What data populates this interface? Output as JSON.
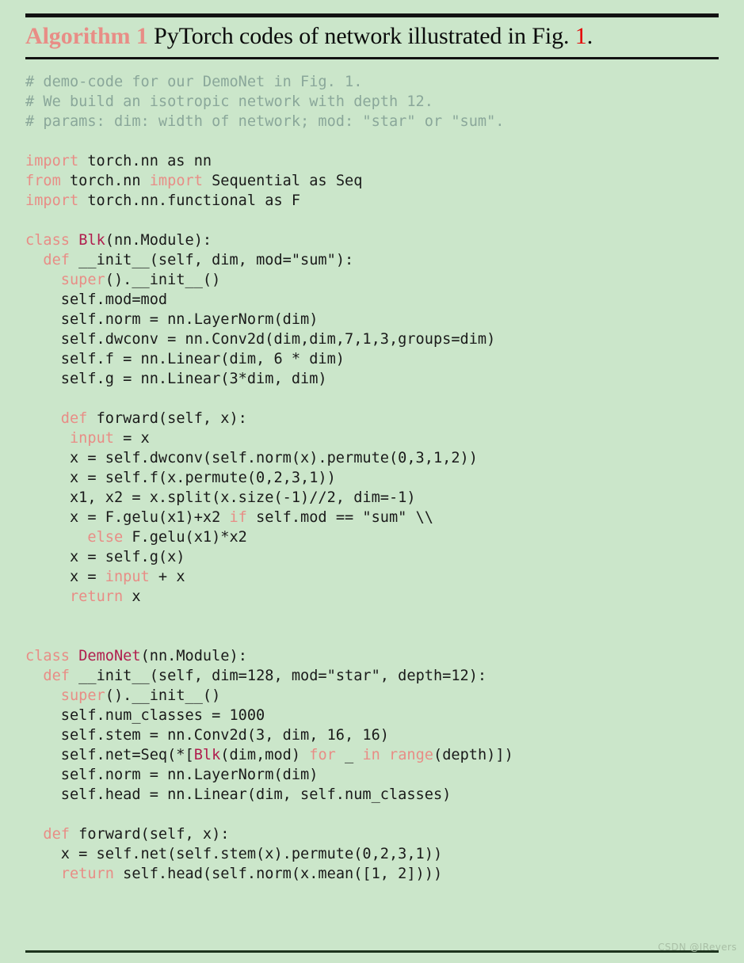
{
  "document": {
    "background_color": "#cbe6ca",
    "rule_color": "#121212"
  },
  "title": {
    "label": "Algorithm 1",
    "text_before": " PyTorch codes of network illustrated in Fig. ",
    "fig_number": "1",
    "text_after": "."
  },
  "colors": {
    "comment": "#8aa79a",
    "keyword": "#e88d86",
    "class_name": "#b01e4e",
    "plain": "#1a1a1a",
    "fig_number": "#e50000"
  },
  "code": {
    "language": "python",
    "lines": [
      [
        {
          "t": "# demo-code for our DemoNet in Fig. 1.",
          "c": "cm"
        }
      ],
      [
        {
          "t": "# We build an isotropic network with depth 12.",
          "c": "cm"
        }
      ],
      [
        {
          "t": "# params: dim: width of network; mod: \"star\" or \"sum\".",
          "c": "cm"
        }
      ],
      [
        {
          "t": "",
          "c": "pl"
        }
      ],
      [
        {
          "t": "import",
          "c": "kw"
        },
        {
          "t": " torch.nn as nn",
          "c": "pl"
        }
      ],
      [
        {
          "t": "from",
          "c": "kw"
        },
        {
          "t": " torch.nn ",
          "c": "pl"
        },
        {
          "t": "import",
          "c": "kw"
        },
        {
          "t": " Sequential as Seq",
          "c": "pl"
        }
      ],
      [
        {
          "t": "import",
          "c": "kw"
        },
        {
          "t": " torch.nn.functional as F",
          "c": "pl"
        }
      ],
      [
        {
          "t": "",
          "c": "pl"
        }
      ],
      [
        {
          "t": "class",
          "c": "kw"
        },
        {
          "t": " ",
          "c": "pl"
        },
        {
          "t": "Blk",
          "c": "cls"
        },
        {
          "t": "(nn.Module):",
          "c": "pl"
        }
      ],
      [
        {
          "t": "  ",
          "c": "pl"
        },
        {
          "t": "def",
          "c": "kw"
        },
        {
          "t": " __init__(self, dim, mod=\"sum\"):",
          "c": "pl"
        }
      ],
      [
        {
          "t": "    ",
          "c": "pl"
        },
        {
          "t": "super",
          "c": "kw"
        },
        {
          "t": "().__init__()",
          "c": "pl"
        }
      ],
      [
        {
          "t": "    self.mod=mod",
          "c": "pl"
        }
      ],
      [
        {
          "t": "    self.norm = nn.LayerNorm(dim)",
          "c": "pl"
        }
      ],
      [
        {
          "t": "    self.dwconv = nn.Conv2d(dim,dim,7,1,3,groups=dim)",
          "c": "pl"
        }
      ],
      [
        {
          "t": "    self.f = nn.Linear(dim, 6 * dim)",
          "c": "pl"
        }
      ],
      [
        {
          "t": "    self.g = nn.Linear(3*dim, dim)",
          "c": "pl"
        }
      ],
      [
        {
          "t": "",
          "c": "pl"
        }
      ],
      [
        {
          "t": "    ",
          "c": "pl"
        },
        {
          "t": "def",
          "c": "kw"
        },
        {
          "t": " forward(self, x):",
          "c": "pl"
        }
      ],
      [
        {
          "t": "     ",
          "c": "pl"
        },
        {
          "t": "input",
          "c": "kw"
        },
        {
          "t": " = x",
          "c": "pl"
        }
      ],
      [
        {
          "t": "     x = self.dwconv(self.norm(x).permute(0,3,1,2))",
          "c": "pl"
        }
      ],
      [
        {
          "t": "     x = self.f(x.permute(0,2,3,1))",
          "c": "pl"
        }
      ],
      [
        {
          "t": "     x1, x2 = x.split(x.size(-1)//2, dim=-1)",
          "c": "pl"
        }
      ],
      [
        {
          "t": "     x = F.gelu(x1)+x2 ",
          "c": "pl"
        },
        {
          "t": "if",
          "c": "kw"
        },
        {
          "t": " self.mod == \"sum\" \\\\",
          "c": "pl"
        }
      ],
      [
        {
          "t": "       ",
          "c": "pl"
        },
        {
          "t": "else",
          "c": "kw"
        },
        {
          "t": " F.gelu(x1)*x2",
          "c": "pl"
        }
      ],
      [
        {
          "t": "     x = self.g(x)",
          "c": "pl"
        }
      ],
      [
        {
          "t": "     x = ",
          "c": "pl"
        },
        {
          "t": "input",
          "c": "kw"
        },
        {
          "t": " + x",
          "c": "pl"
        }
      ],
      [
        {
          "t": "     ",
          "c": "pl"
        },
        {
          "t": "return",
          "c": "kw"
        },
        {
          "t": " x",
          "c": "pl"
        }
      ],
      [
        {
          "t": "",
          "c": "pl"
        }
      ],
      [
        {
          "t": "",
          "c": "pl"
        }
      ],
      [
        {
          "t": "class",
          "c": "kw"
        },
        {
          "t": " ",
          "c": "pl"
        },
        {
          "t": "DemoNet",
          "c": "cls"
        },
        {
          "t": "(nn.Module):",
          "c": "pl"
        }
      ],
      [
        {
          "t": "  ",
          "c": "pl"
        },
        {
          "t": "def",
          "c": "kw"
        },
        {
          "t": " __init__(self, dim=128, mod=\"star\", depth=12):",
          "c": "pl"
        }
      ],
      [
        {
          "t": "    ",
          "c": "pl"
        },
        {
          "t": "super",
          "c": "kw"
        },
        {
          "t": "().__init__()",
          "c": "pl"
        }
      ],
      [
        {
          "t": "    self.num_classes = 1000",
          "c": "pl"
        }
      ],
      [
        {
          "t": "    self.stem = nn.Conv2d(3, dim, 16, 16)",
          "c": "pl"
        }
      ],
      [
        {
          "t": "    self.net=Seq(*[",
          "c": "pl"
        },
        {
          "t": "Blk",
          "c": "cls"
        },
        {
          "t": "(dim,mod) ",
          "c": "pl"
        },
        {
          "t": "for",
          "c": "kw"
        },
        {
          "t": " _ ",
          "c": "pl"
        },
        {
          "t": "in",
          "c": "kw"
        },
        {
          "t": " ",
          "c": "pl"
        },
        {
          "t": "range",
          "c": "kw"
        },
        {
          "t": "(depth)])",
          "c": "pl"
        }
      ],
      [
        {
          "t": "    self.norm = nn.LayerNorm(dim)",
          "c": "pl"
        }
      ],
      [
        {
          "t": "    self.head = nn.Linear(dim, self.num_classes)",
          "c": "pl"
        }
      ],
      [
        {
          "t": "",
          "c": "pl"
        }
      ],
      [
        {
          "t": "  ",
          "c": "pl"
        },
        {
          "t": "def",
          "c": "kw"
        },
        {
          "t": " forward(self, x):",
          "c": "pl"
        }
      ],
      [
        {
          "t": "    x = self.net(self.stem(x).permute(0,2,3,1))",
          "c": "pl"
        }
      ],
      [
        {
          "t": "    ",
          "c": "pl"
        },
        {
          "t": "return",
          "c": "kw"
        },
        {
          "t": " self.head(self.norm(x.mean([1, 2])))",
          "c": "pl"
        }
      ]
    ]
  },
  "watermark": {
    "text": "CSDN @IRevers"
  }
}
